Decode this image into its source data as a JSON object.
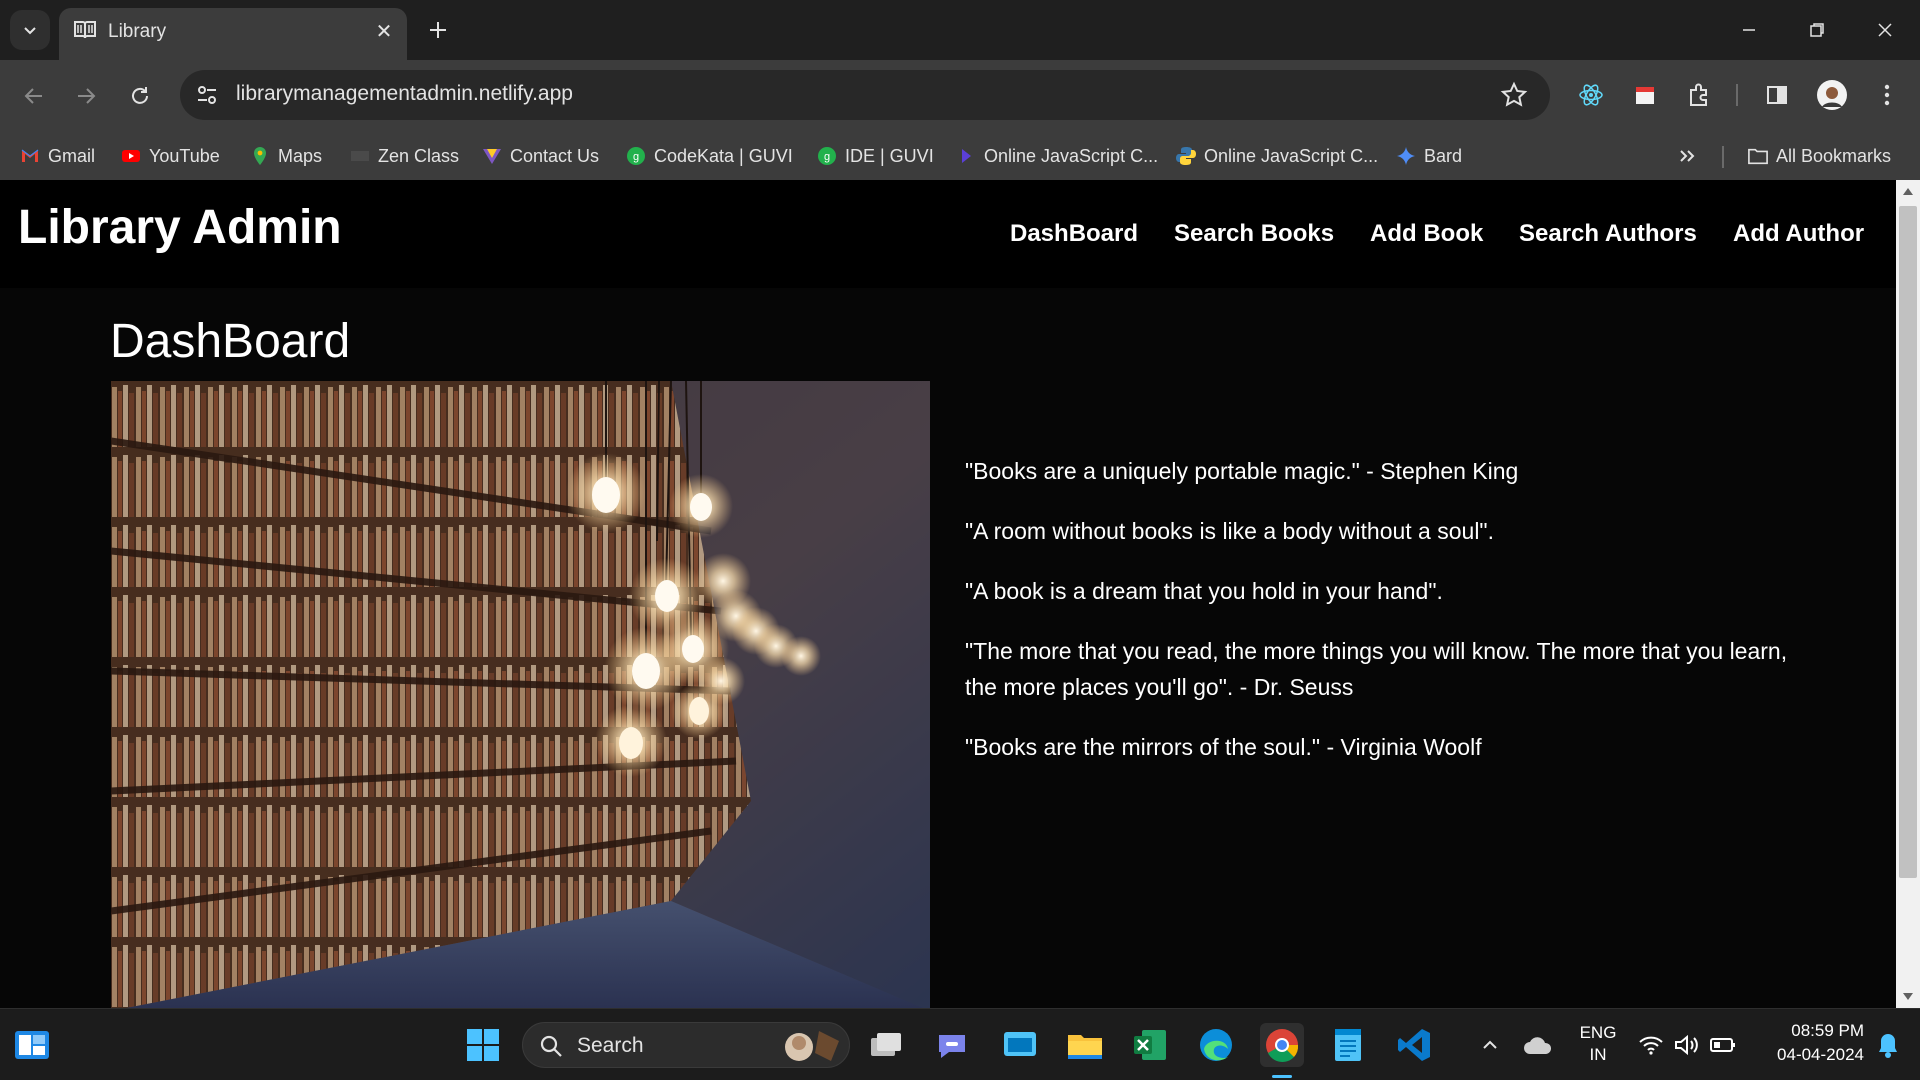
{
  "browser": {
    "tab_title": "Library",
    "url": "librarymanagementadmin.netlify.app",
    "bookmarks": [
      {
        "label": "Gmail",
        "icon": "gmail-icon"
      },
      {
        "label": "YouTube",
        "icon": "youtube-icon"
      },
      {
        "label": "Maps",
        "icon": "maps-icon"
      },
      {
        "label": "Zen Class",
        "icon": "zen-class-icon"
      },
      {
        "label": "Contact Us",
        "icon": "contact-us-icon"
      },
      {
        "label": "CodeKata | GUVI",
        "icon": "guvi-icon"
      },
      {
        "label": "IDE | GUVI",
        "icon": "guvi-icon"
      },
      {
        "label": "Online JavaScript C...",
        "icon": "js-compiler-icon"
      },
      {
        "label": "Online JavaScript C...",
        "icon": "python-icon"
      },
      {
        "label": "Bard",
        "icon": "bard-icon"
      }
    ],
    "all_bookmarks_label": "All Bookmarks"
  },
  "site": {
    "brand": "Library Admin",
    "nav": [
      "DashBoard",
      "Search Books",
      "Add Book",
      "Search Authors",
      "Add Author"
    ],
    "page_title": "DashBoard",
    "quotes": [
      "\"Books are a uniquely portable magic.\" - Stephen King",
      "\"A room without books is like a body without a soul\".",
      "\"A book is a dream that you hold in your hand\".",
      "\"The more that you read, the more things you will know. The more that you learn, the more places you'll go\". - Dr. Seuss",
      "\"Books are the mirrors of the soul.\" - Virginia Woolf"
    ]
  },
  "taskbar": {
    "search_label": "Search",
    "language": "ENG",
    "region": "IN",
    "time": "08:59 PM",
    "date": "04-04-2024"
  },
  "colors": {
    "tab_strip": "#1f1f1f",
    "toolbar": "#3c3c3c",
    "page_background": "#060606",
    "header_background": "#000000",
    "text": "#ffffff"
  }
}
